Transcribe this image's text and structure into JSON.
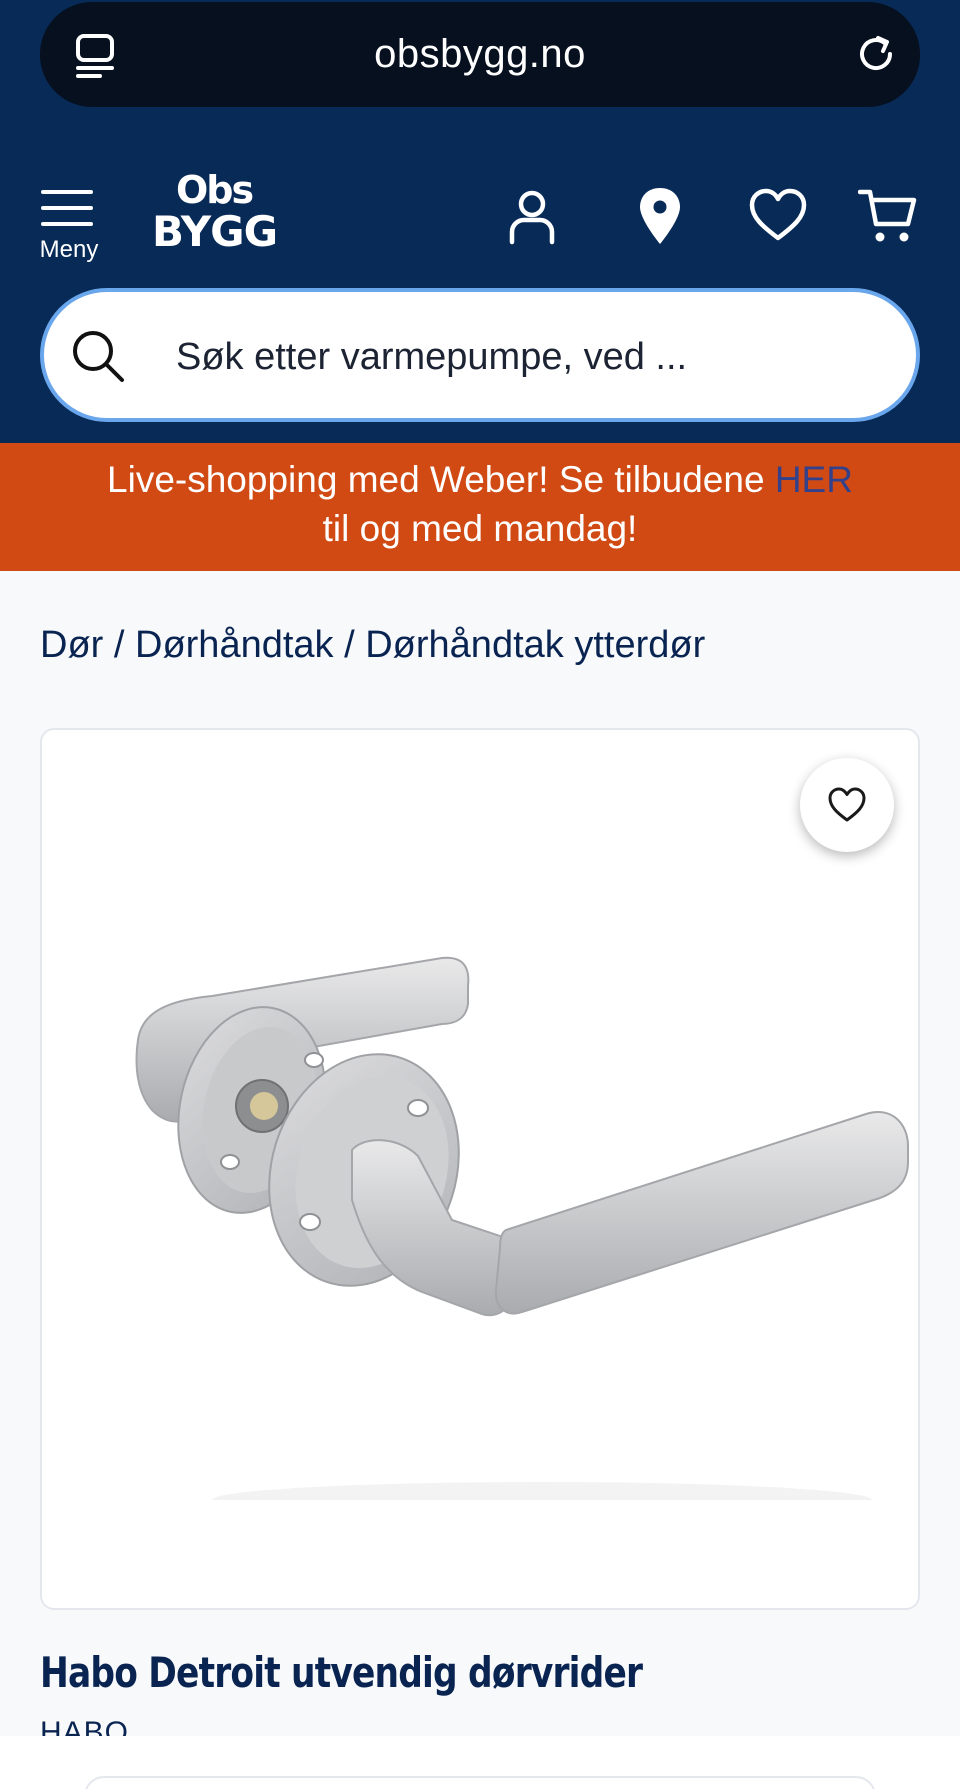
{
  "browser": {
    "url": "obsbygg.no",
    "tabs_icon": "tabs-icon",
    "reload_icon": "reload-icon"
  },
  "header": {
    "menu_label": "Meny",
    "logo_top": "Obs",
    "logo_bottom": "BYGG",
    "icons": [
      "user-icon",
      "location-pin-icon",
      "heart-icon",
      "cart-icon"
    ]
  },
  "search": {
    "placeholder": "Søk etter varmepumpe, ved ..."
  },
  "banner": {
    "text_before": "Live-shopping med Weber! Se tilbudene ",
    "link": "HER",
    "text_after": "til og med mandag!"
  },
  "breadcrumb": {
    "items": [
      "Dør",
      "Dørhåndtak",
      "Dørhåndtak ytterdør"
    ],
    "separator": "/"
  },
  "product": {
    "title": "Habo Detroit utvendig dørvrider",
    "brand": "HABO",
    "image": "door-lever-handle-image"
  },
  "colors": {
    "header_bg": "#072a57",
    "banner_bg": "#d14a14",
    "banner_link": "#33418a",
    "search_border": "#6aa6ec",
    "text_primary": "#0a2452"
  }
}
